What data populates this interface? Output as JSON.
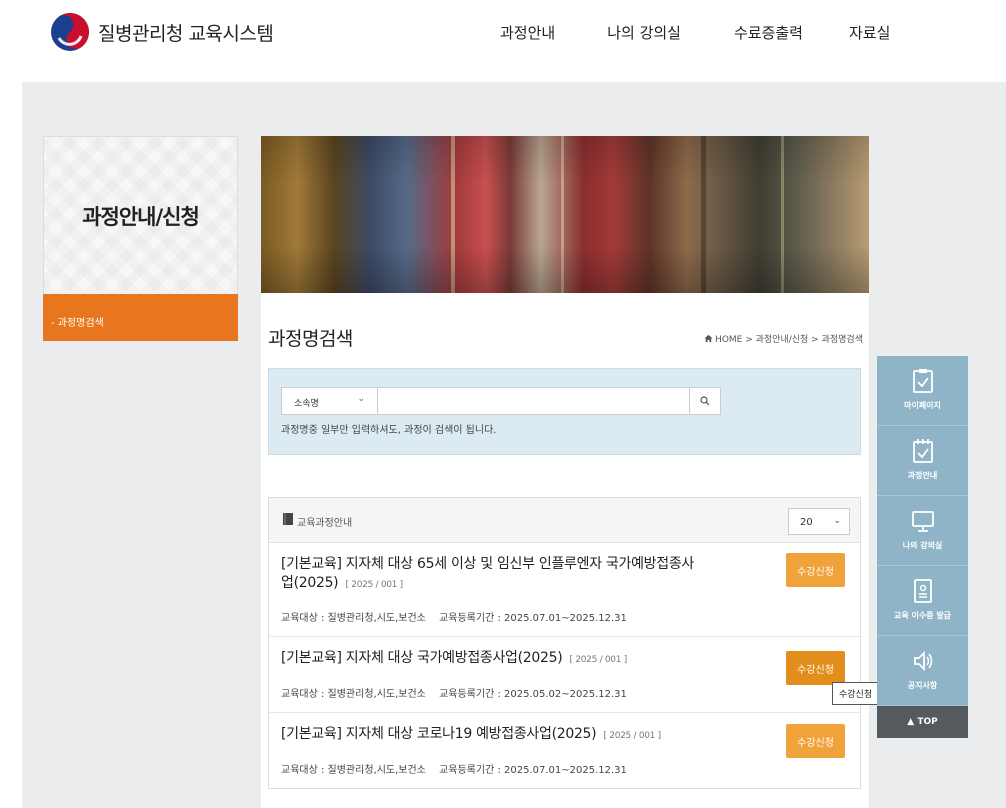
{
  "header": {
    "logo_text": "질병관리청 교육시스템",
    "nav": [
      "과정안내",
      "나의 강의실",
      "수료증출력",
      "자료실"
    ]
  },
  "sidebar": {
    "title": "과정안내/신청",
    "items": [
      {
        "label": "- 과정명검색"
      }
    ]
  },
  "main": {
    "page_title": "과정명검색",
    "breadcrumb": "HOME > 과정안내/신청 > 과정명검색",
    "search": {
      "select_value": "소속명",
      "input_value": "",
      "hint": "과정명중 일부만 입력하셔도, 과정이 검색이 됩니다."
    },
    "course_panel": {
      "title": "교육과정안내",
      "page_size": "20",
      "courses": [
        {
          "title": "[기본교육] 지자체 대상 65세 이상 및 임신부 인플루엔자 국가예방접종사업(2025)",
          "code": "[ 2025 / 001 ]",
          "target": "교육대상 : 질병관리청,시도,보건소",
          "period": "교육등록기간 : 2025.07.01~2025.12.31",
          "apply_label": "수강신청"
        },
        {
          "title": "[기본교육] 지자체 대상 국가예방접종사업(2025)",
          "code": "[ 2025 / 001 ]",
          "target": "교육대상 : 질병관리청,시도,보건소",
          "period": "교육등록기간 : 2025.05.02~2025.12.31",
          "apply_label": "수강신청"
        },
        {
          "title": "[기본교육] 지자체 대상 코로나19 예방접종사업(2025)",
          "code": "[ 2025 / 001 ]",
          "target": "교육대상 : 질병관리청,시도,보건소",
          "period": "교육등록기간 : 2025.07.01~2025.12.31",
          "apply_label": "수강신청"
        }
      ]
    },
    "tooltip": "수강신청"
  },
  "quick_menu": {
    "items": [
      {
        "label": "마이페이지",
        "icon": "checklist-icon"
      },
      {
        "label": "과정안내",
        "icon": "calendar-check-icon"
      },
      {
        "label": "나의 강의실",
        "icon": "monitor-icon"
      },
      {
        "label": "교육 이수증 발급",
        "icon": "certificate-icon"
      },
      {
        "label": "공지사항",
        "icon": "speaker-icon"
      }
    ],
    "top_label": "▲ TOP"
  },
  "colors": {
    "accent_orange": "#e8761e",
    "button_orange": "#f0a33a",
    "search_bg": "#dceaf1",
    "quick_menu_bg": "#8fb4c7",
    "background_gray": "#eaeced"
  }
}
